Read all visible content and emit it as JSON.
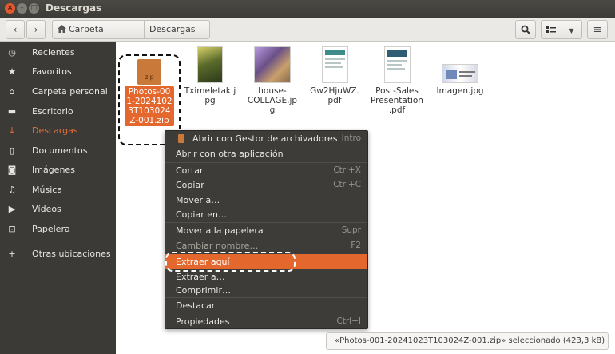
{
  "window": {
    "title": "Descargas"
  },
  "toolbar": {
    "back_icon": "‹",
    "forward_icon": "›",
    "home_label": "Carpeta personal",
    "current_label": "Descargas"
  },
  "sidebar": {
    "items": [
      {
        "label": "Recientes",
        "icon": "clock-icon"
      },
      {
        "label": "Favoritos",
        "icon": "star-icon"
      },
      {
        "label": "Carpeta personal",
        "icon": "home-icon"
      },
      {
        "label": "Escritorio",
        "icon": "folder-icon"
      },
      {
        "label": "Descargas",
        "icon": "download-icon"
      },
      {
        "label": "Documentos",
        "icon": "document-icon"
      },
      {
        "label": "Imágenes",
        "icon": "camera-icon"
      },
      {
        "label": "Música",
        "icon": "music-icon"
      },
      {
        "label": "Vídeos",
        "icon": "video-icon"
      },
      {
        "label": "Papelera",
        "icon": "trash-icon"
      },
      {
        "label": "Otras ubicaciones",
        "icon": "plus-icon"
      }
    ]
  },
  "files": [
    {
      "name": "Photos-001-20241023T103024Z-001.zip",
      "badge": "zip"
    },
    {
      "name": "Tximeletak.jpg"
    },
    {
      "name": "house-COLLAGE.jpg"
    },
    {
      "name": "Gw2HjuWZ.pdf"
    },
    {
      "name": "Post-Sales Presentation.pdf"
    },
    {
      "name": "Imagen.jpg"
    }
  ],
  "context_menu": {
    "items": [
      {
        "label": "Abrir con Gestor de archivadores",
        "accel": "Intro"
      },
      {
        "label": "Abrir con otra aplicación",
        "accel": ""
      },
      {
        "label": "Cortar",
        "accel": "Ctrl+X"
      },
      {
        "label": "Copiar",
        "accel": "Ctrl+C"
      },
      {
        "label": "Mover a…",
        "accel": ""
      },
      {
        "label": "Copiar en…",
        "accel": ""
      },
      {
        "label": "Mover a la papelera",
        "accel": "Supr"
      },
      {
        "label": "Cambiar nombre…",
        "accel": "F2"
      },
      {
        "label": "Extraer aquí",
        "accel": ""
      },
      {
        "label": "Extraer a…",
        "accel": ""
      },
      {
        "label": "Comprimir…",
        "accel": ""
      },
      {
        "label": "Destacar",
        "accel": ""
      },
      {
        "label": "Propiedades",
        "accel": "Ctrl+I"
      }
    ]
  },
  "status": {
    "text": "«Photos-001-20241023T103024Z-001.zip» seleccionado  (423,3 kB)"
  },
  "colors": {
    "accent": "#e4672e",
    "sidebar_bg": "#3b3a36",
    "titlebar_bg": "#3d3c38"
  }
}
